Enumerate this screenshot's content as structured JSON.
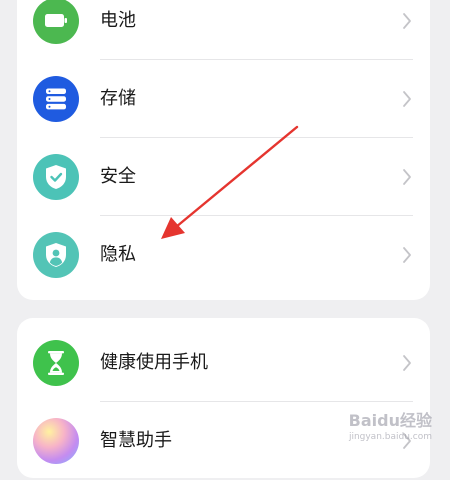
{
  "settings_group_1": {
    "items": [
      {
        "label": "电池",
        "icon": "battery-icon",
        "color": "#4cb850"
      },
      {
        "label": "存储",
        "icon": "storage-icon",
        "color": "#1f5be0"
      },
      {
        "label": "安全",
        "icon": "shield-check-icon",
        "color": "#4cc3b7"
      },
      {
        "label": "隐私",
        "icon": "privacy-shield-icon",
        "color": "#53c4b6"
      }
    ]
  },
  "settings_group_2": {
    "items": [
      {
        "label": "健康使用手机",
        "icon": "hourglass-icon",
        "color": "#3fc24c"
      },
      {
        "label": "智慧助手",
        "icon": "smart-assistant-icon",
        "color": "#f08bb0"
      }
    ]
  },
  "annotation": {
    "color": "#e5352f"
  },
  "watermark": {
    "text": "Baidu经验",
    "sub": "jingyan.baidu.com"
  }
}
